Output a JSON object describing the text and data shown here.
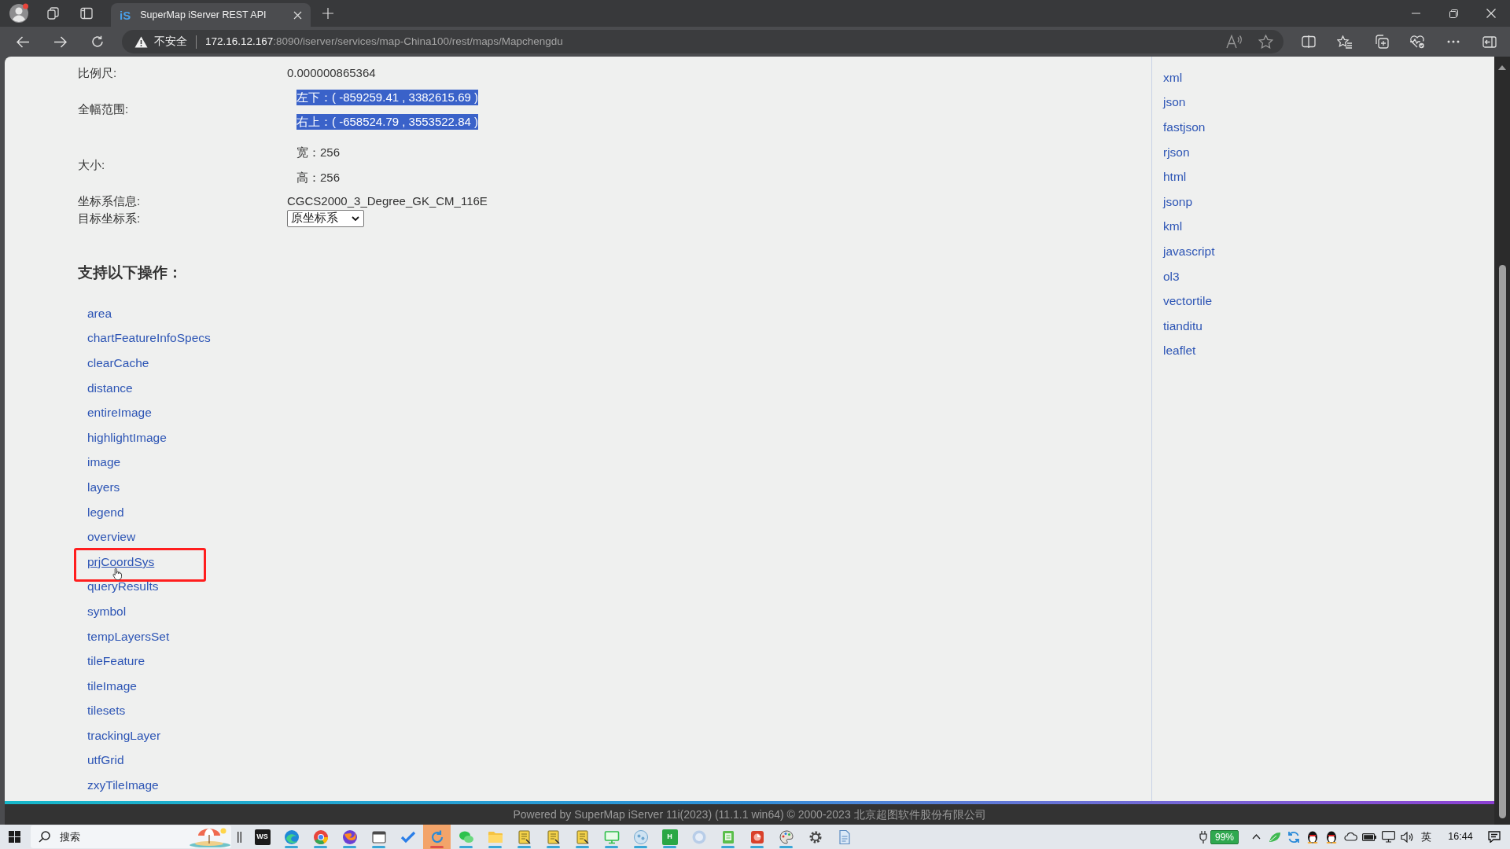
{
  "browser": {
    "tab": {
      "favicon": "iS",
      "title": "SuperMap iServer REST API",
      "selected": true
    },
    "address": {
      "security": "不安全",
      "host": "172.16.12.167",
      "path": ":8090/iserver/services/map-China100/rest/maps/Mapchengdu"
    }
  },
  "properties": [
    {
      "label": "比例尺:",
      "kind": "text",
      "value": "0.000000865364"
    },
    {
      "label": "全幅范围:",
      "kind": "list",
      "values": [
        {
          "text": "左下：( -859259.41 , 3382615.69 )",
          "selected": true
        },
        {
          "text": "右上：( -658524.79 , 3553522.84 )",
          "selected": true
        }
      ]
    },
    {
      "label": "大小:",
      "kind": "list",
      "values": [
        {
          "text": "宽：256",
          "selected": false
        },
        {
          "text": "高：256",
          "selected": false
        }
      ]
    },
    {
      "label": "坐标系信息:",
      "kind": "text",
      "value": "CGCS2000_3_Degree_GK_CM_116E"
    },
    {
      "label": "目标坐标系:",
      "kind": "select",
      "value": "原坐标系"
    }
  ],
  "operations": {
    "heading": "支持以下操作：",
    "items": [
      {
        "label": "area",
        "hovered": false,
        "boxed": false
      },
      {
        "label": "chartFeatureInfoSpecs",
        "hovered": false,
        "boxed": false
      },
      {
        "label": "clearCache",
        "hovered": false,
        "boxed": false
      },
      {
        "label": "distance",
        "hovered": false,
        "boxed": false
      },
      {
        "label": "entireImage",
        "hovered": false,
        "boxed": false
      },
      {
        "label": "highlightImage",
        "hovered": false,
        "boxed": false
      },
      {
        "label": "image",
        "hovered": false,
        "boxed": false
      },
      {
        "label": "layers",
        "hovered": false,
        "boxed": false
      },
      {
        "label": "legend",
        "hovered": false,
        "boxed": false
      },
      {
        "label": "overview",
        "hovered": false,
        "boxed": false
      },
      {
        "label": "prjCoordSys",
        "hovered": true,
        "boxed": true
      },
      {
        "label": "queryResults",
        "hovered": false,
        "boxed": false
      },
      {
        "label": "symbol",
        "hovered": false,
        "boxed": false
      },
      {
        "label": "tempLayersSet",
        "hovered": false,
        "boxed": false
      },
      {
        "label": "tileFeature",
        "hovered": false,
        "boxed": false
      },
      {
        "label": "tileImage",
        "hovered": false,
        "boxed": false
      },
      {
        "label": "tilesets",
        "hovered": false,
        "boxed": false
      },
      {
        "label": "trackingLayer",
        "hovered": false,
        "boxed": false
      },
      {
        "label": "utfGrid",
        "hovered": false,
        "boxed": false
      },
      {
        "label": "zxyTileImage",
        "hovered": false,
        "boxed": false
      }
    ]
  },
  "formats": [
    "xml",
    "json",
    "fastjson",
    "rjson",
    "html",
    "jsonp",
    "kml",
    "javascript",
    "ol3",
    "vectortile",
    "tianditu",
    "leaflet"
  ],
  "footer": "Powered by SuperMap iServer 11i(2023) (11.1.1 win64) © 2000-2023 北京超图软件股份有限公司",
  "taskbar": {
    "search": {
      "placeholder": "搜索"
    },
    "apps": [
      {
        "kind": "tile",
        "label": "WS",
        "color": "#1b1b1b",
        "active": false,
        "running": false
      },
      {
        "kind": "swirl",
        "active": false,
        "running": true
      },
      {
        "kind": "segmented",
        "active": false,
        "running": true
      },
      {
        "kind": "flame",
        "active": false,
        "running": true
      },
      {
        "kind": "window",
        "active": false,
        "running": true
      },
      {
        "kind": "check",
        "active": false,
        "running": false
      },
      {
        "kind": "refresh",
        "active": true,
        "running": true
      },
      {
        "kind": "chat",
        "active": false,
        "running": true
      },
      {
        "kind": "folder",
        "active": false,
        "running": true
      },
      {
        "kind": "note",
        "active": false,
        "running": true
      },
      {
        "kind": "note",
        "active": false,
        "running": true
      },
      {
        "kind": "note",
        "active": false,
        "running": true
      },
      {
        "kind": "monitor",
        "active": false,
        "running": true
      },
      {
        "kind": "bubble",
        "active": false,
        "running": true
      },
      {
        "kind": "tile",
        "label": "H",
        "color": "#2aa745",
        "active": false,
        "running": true
      },
      {
        "kind": "disc",
        "active": false,
        "running": false
      },
      {
        "kind": "notebook",
        "active": false,
        "running": true
      },
      {
        "kind": "slides",
        "active": false,
        "running": true
      },
      {
        "kind": "paint",
        "active": false,
        "running": true
      },
      {
        "kind": "gear",
        "active": false,
        "running": false
      },
      {
        "kind": "document",
        "active": false,
        "running": false
      }
    ],
    "battery": "99%",
    "input_method": "英",
    "time": "16:44"
  }
}
